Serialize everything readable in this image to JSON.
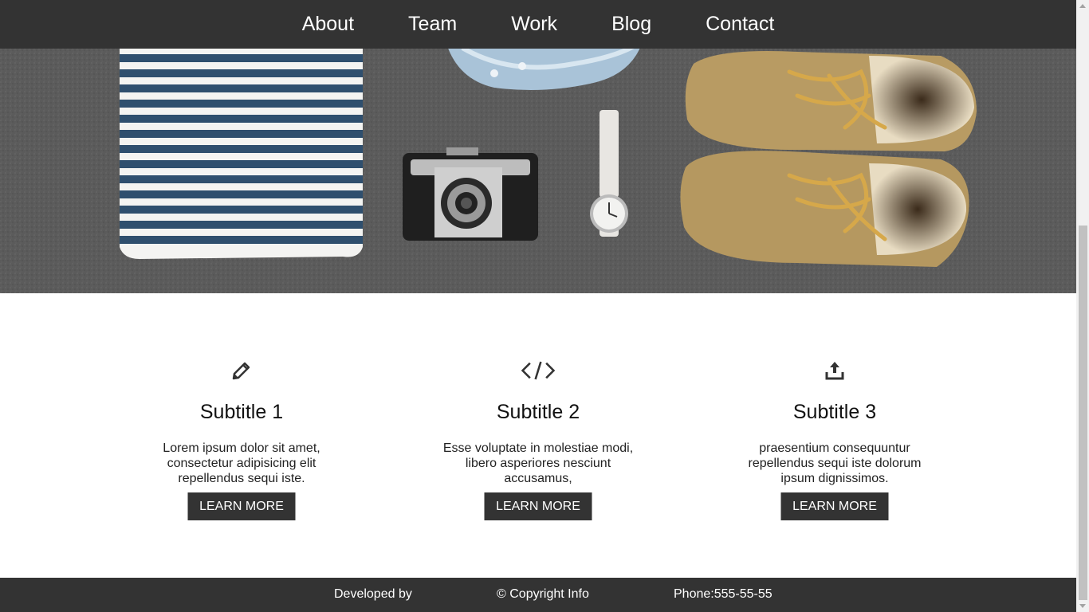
{
  "nav": {
    "items": [
      {
        "label": "About"
      },
      {
        "label": "Team"
      },
      {
        "label": "Work"
      },
      {
        "label": "Blog"
      },
      {
        "label": "Contact"
      }
    ]
  },
  "hero": {
    "image_description": "flat lay of striped shirt, scarf, vintage camera, wristwatch and leather boots on grey carpet"
  },
  "services": [
    {
      "icon": "pencil-icon",
      "title": "Subtitle 1",
      "text": "Lorem ipsum dolor sit amet, consectetur adipisicing elit repellendus sequi iste.",
      "button": "LEARN MORE"
    },
    {
      "icon": "code-icon",
      "title": "Subtitle 2",
      "text": "Esse voluptate in molestiae modi, libero asperiores nesciunt accusamus,",
      "button": "LEARN MORE"
    },
    {
      "icon": "upload-icon",
      "title": "Subtitle 3",
      "text": "praesentium consequuntur repellendus sequi iste dolorum ipsum dignissimos.",
      "button": "LEARN MORE"
    }
  ],
  "footer": {
    "developed": "Developed by",
    "copyright": "© Copyright Info",
    "phone": "Phone:555-55-55"
  },
  "colors": {
    "dark": "#333333",
    "background": "#ffffff"
  }
}
